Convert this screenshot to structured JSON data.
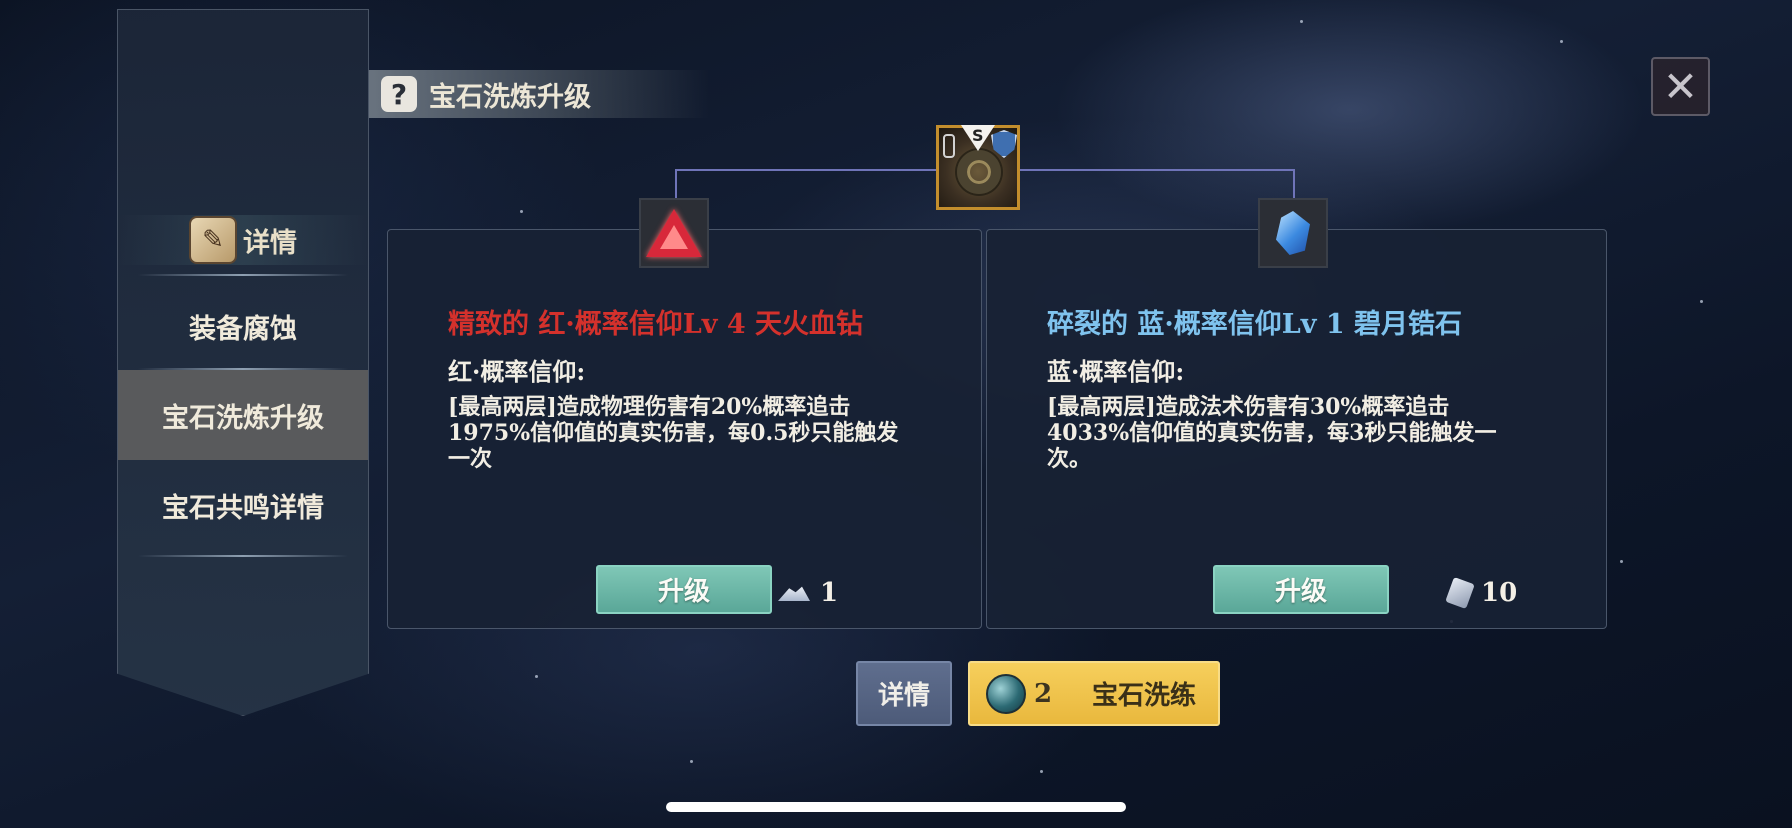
{
  "sidebar": {
    "detail_label": "详情",
    "items": [
      {
        "label": "装备腐蚀",
        "active": false
      },
      {
        "label": "宝石洗炼升级",
        "active": true
      },
      {
        "label": "宝石共鸣详情",
        "active": false
      }
    ]
  },
  "header": {
    "title": "宝石洗炼升级",
    "help_icon": "?"
  },
  "close": {
    "icon": "✕"
  },
  "center_item": {
    "badge": "S"
  },
  "gems": [
    {
      "name": "精致的 红·概率信仰Lv 4 天火血钻",
      "name_color": "#d4312c",
      "attr": "红·概率信仰:",
      "desc": "[最高两层]造成物理伤害有20%概率追击1975%信仰值的真实伤害，每0.5秒只能触发一次",
      "upgrade_label": "升级",
      "cost_icon": "powder-icon",
      "cost": "1"
    },
    {
      "name": "碎裂的 蓝·概率信仰Lv 1 碧月锆石",
      "name_color": "#7fc3ee",
      "attr": "蓝·概率信仰:",
      "desc": "[最高两层]造成法术伤害有30%概率追击4033%信仰值的真实伤害，每3秒只能触发一次。",
      "upgrade_label": "升级",
      "cost_icon": "stone-icon",
      "cost": "10"
    }
  ],
  "bottom": {
    "detail_label": "详情",
    "refine_count": "2",
    "refine_label": "宝石洗练"
  }
}
